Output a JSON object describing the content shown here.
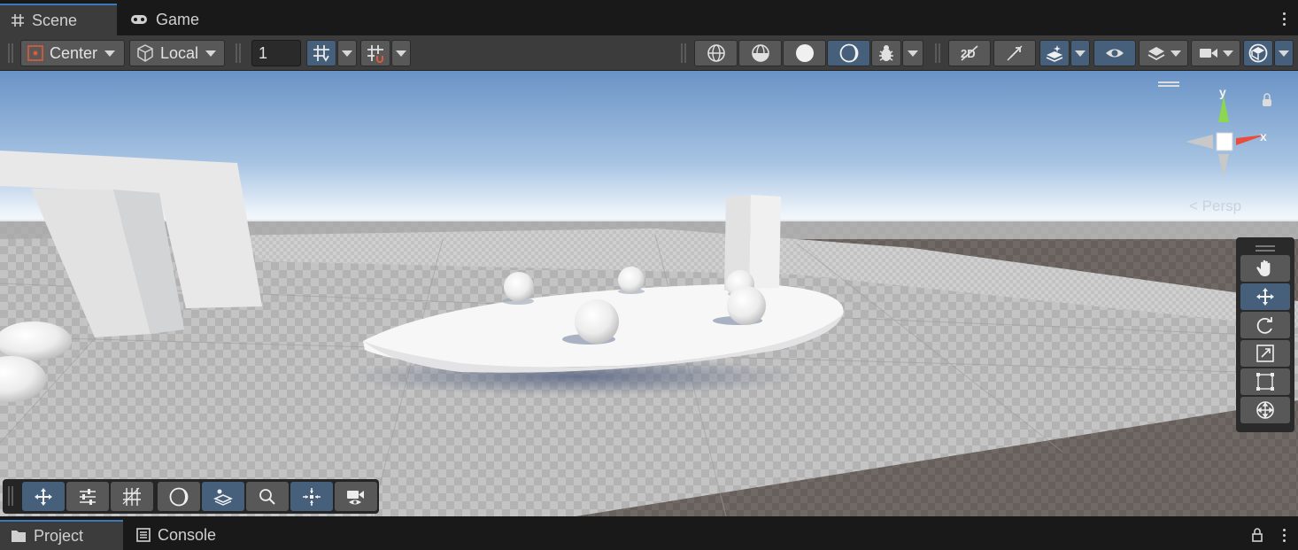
{
  "tabs_top": [
    {
      "label": "Scene",
      "icon": "grid-hash-icon",
      "active": true
    },
    {
      "label": "Game",
      "icon": "gamepad-icon",
      "active": false
    }
  ],
  "toolbar": {
    "pivot_mode": "Center",
    "pivot_rotation": "Local",
    "snap_increment": "1"
  },
  "gizmo": {
    "y_label": "y",
    "x_label": "x",
    "projection": "< Persp"
  },
  "tools": [
    "hand-tool",
    "move-tool",
    "rotate-tool",
    "scale-tool",
    "rect-tool",
    "transform-tool"
  ],
  "active_tool": "move-tool",
  "overlays": [
    "move-overlay",
    "sliders-overlay",
    "grid-overlay",
    "shading-overlay",
    "layers-overlay",
    "search-overlay",
    "pivot-overlay",
    "camera-overlay"
  ],
  "tabs_bottom": [
    {
      "label": "Project",
      "icon": "folder-icon",
      "active": true
    },
    {
      "label": "Console",
      "icon": "console-icon",
      "active": false
    }
  ],
  "colors": {
    "accent": "#46607c",
    "tab_highlight": "#3a79bb",
    "sky_top": "#6a93c6",
    "ground": "#6e6763"
  }
}
